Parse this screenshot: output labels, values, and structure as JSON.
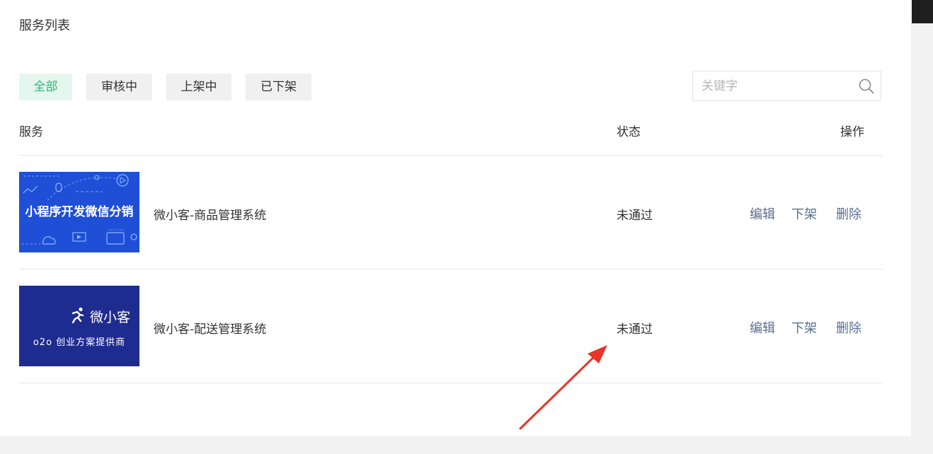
{
  "page": {
    "title": "服务列表"
  },
  "filters": [
    {
      "label": "全部",
      "active": true
    },
    {
      "label": "审核中",
      "active": false
    },
    {
      "label": "上架中",
      "active": false
    },
    {
      "label": "已下架",
      "active": false
    }
  ],
  "search": {
    "placeholder": "关键字",
    "value": "",
    "icon": "search-icon"
  },
  "table": {
    "headers": {
      "service": "服务",
      "status": "状态",
      "actions": "操作"
    },
    "rows": [
      {
        "thumbnail_text": "小程序开发微信分销",
        "name": "微小客-商品管理系统",
        "status": "未通过",
        "actions": {
          "edit": "编辑",
          "unlist": "下架",
          "delete": "删除"
        }
      },
      {
        "thumbnail_brand": "微小客",
        "thumbnail_text": "o2o 创业方案提供商",
        "name": "微小客-配送管理系统",
        "status": "未通过",
        "actions": {
          "edit": "编辑",
          "unlist": "下架",
          "delete": "删除"
        }
      }
    ]
  },
  "colors": {
    "accent_green": "#2bb673",
    "link_blue": "#5a6e92",
    "annotation_red": "#e8342a",
    "thumb1_bg": "#1f4fd6",
    "thumb2_bg": "#1f2c8f"
  }
}
